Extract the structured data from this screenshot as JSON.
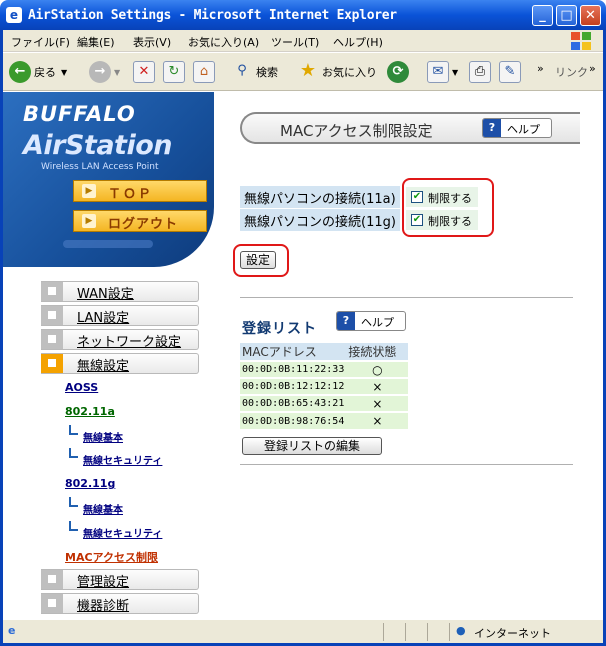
{
  "window": {
    "title": "AirStation Settings - Microsoft Internet Explorer",
    "minimize": "_",
    "maximize": "□",
    "close": "✕"
  },
  "menu": [
    "ファイル(F)",
    "編集(E)",
    "表示(V)",
    "お気に入り(A)",
    "ツール(T)",
    "ヘルプ(H)"
  ],
  "toolbar": {
    "back": "戻る",
    "search": "検索",
    "favorites": "お気に入り",
    "links": "リンク",
    "more": "»"
  },
  "brand": {
    "logo": "BUFFALO",
    "product": "AirStation",
    "tagline": "Wireless LAN Access Point"
  },
  "nav": {
    "top": "ＴＯＰ",
    "logout": "ログアウト"
  },
  "sidebar": {
    "items": [
      "WAN設定",
      "LAN設定",
      "ネットワーク設定",
      "無線設定"
    ],
    "aoss": "AOSS",
    "band_a": "802.11a",
    "band_a_basic": "無線基本",
    "band_a_security": "無線セキュリティ",
    "band_g": "802.11g",
    "band_g_basic": "無線基本",
    "band_g_security": "無線セキュリティ",
    "mac_filter": "MACアクセス制限",
    "admin": "管理設定",
    "diag": "機器診断"
  },
  "main": {
    "title": "MACアクセス制限設定",
    "help": "ヘルプ",
    "row_a_label": "無線パソコンの接続(11a)",
    "row_g_label": "無線パソコンの接続(11g)",
    "restrict_label": "制限する",
    "check_mark": "✔",
    "apply": "設定",
    "list_title": "登録リスト",
    "list_help": "ヘルプ",
    "col_mac": "MACアドレス",
    "col_status": "接続状態",
    "rows": [
      {
        "mac": "00:0D:0B:11:22:33",
        "status": "○"
      },
      {
        "mac": "00:0D:0B:12:12:12",
        "status": "×"
      },
      {
        "mac": "00:0D:0B:65:43:21",
        "status": "×"
      },
      {
        "mac": "00:0D:0B:98:76:54",
        "status": "×"
      }
    ],
    "edit_list": "登録リストの編集"
  },
  "status": {
    "zone": "インターネット"
  }
}
